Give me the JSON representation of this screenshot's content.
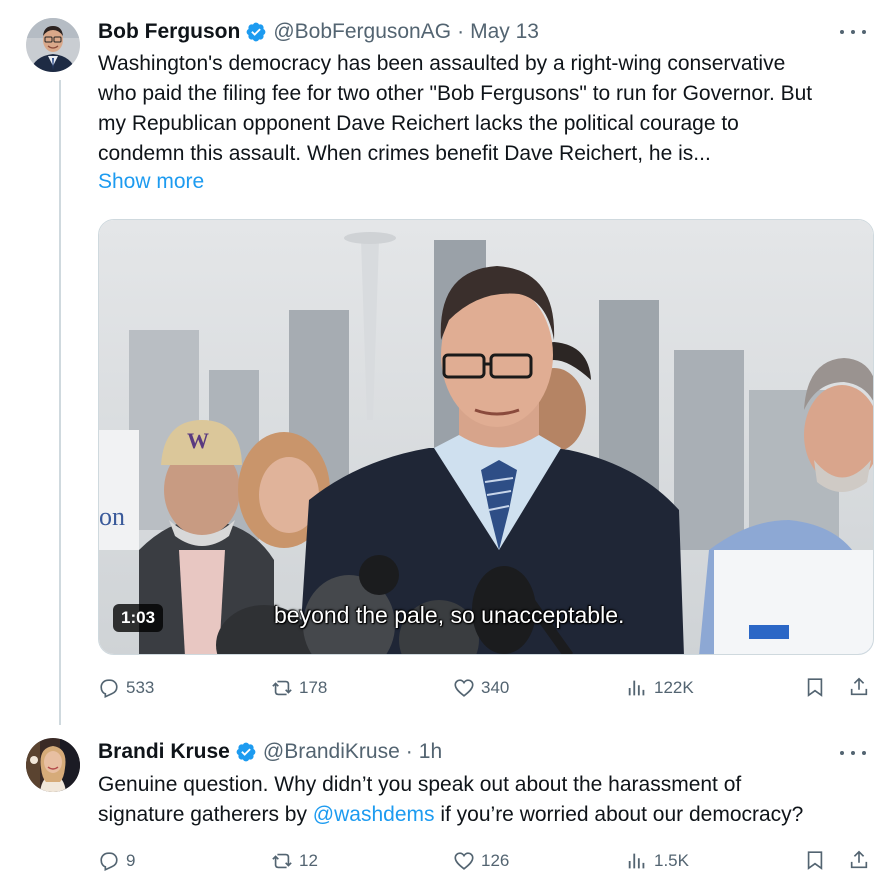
{
  "tweets": [
    {
      "display_name": "Bob Ferguson",
      "handle": "@BobFergusonAG",
      "separator": "·",
      "time": "May 13",
      "text_lines": [
        "Washington's democracy has been assaulted by a right-wing conservative",
        "who paid the filing fee for two other \"Bob Fergusons\" to run for Governor. But",
        "my Republican opponent Dave Reichert lacks the political courage to",
        "condemn this assault. When crimes benefit Dave Reichert, he is..."
      ],
      "show_more": "Show more",
      "video": {
        "duration": "1:03",
        "caption": "beyond the pale, so unacceptable.",
        "cap_letter": "W",
        "sign_fragment": "on"
      },
      "stats": {
        "replies": "533",
        "reposts": "178",
        "likes": "340",
        "views": "122K"
      }
    },
    {
      "display_name": "Brandi Kruse",
      "handle": "@BrandiKruse",
      "separator": "·",
      "time": "1h",
      "text_before": "Genuine question. Why didn’t you speak out about the harassment of",
      "text_line2_before": "signature gatherers by ",
      "mention": "@washdems",
      "text_line2_after": " if you’re worried about our democracy?",
      "stats": {
        "replies": "9",
        "reposts": "12",
        "likes": "126",
        "views": "1.5K"
      }
    }
  ],
  "colors": {
    "accent": "#1d9bf0",
    "muted": "#536471",
    "text": "#0f1419",
    "line": "#cfd9de"
  },
  "icons": [
    "verified-badge-icon",
    "more-icon",
    "reply-icon",
    "repost-icon",
    "like-icon",
    "views-icon",
    "bookmark-icon",
    "share-icon"
  ]
}
